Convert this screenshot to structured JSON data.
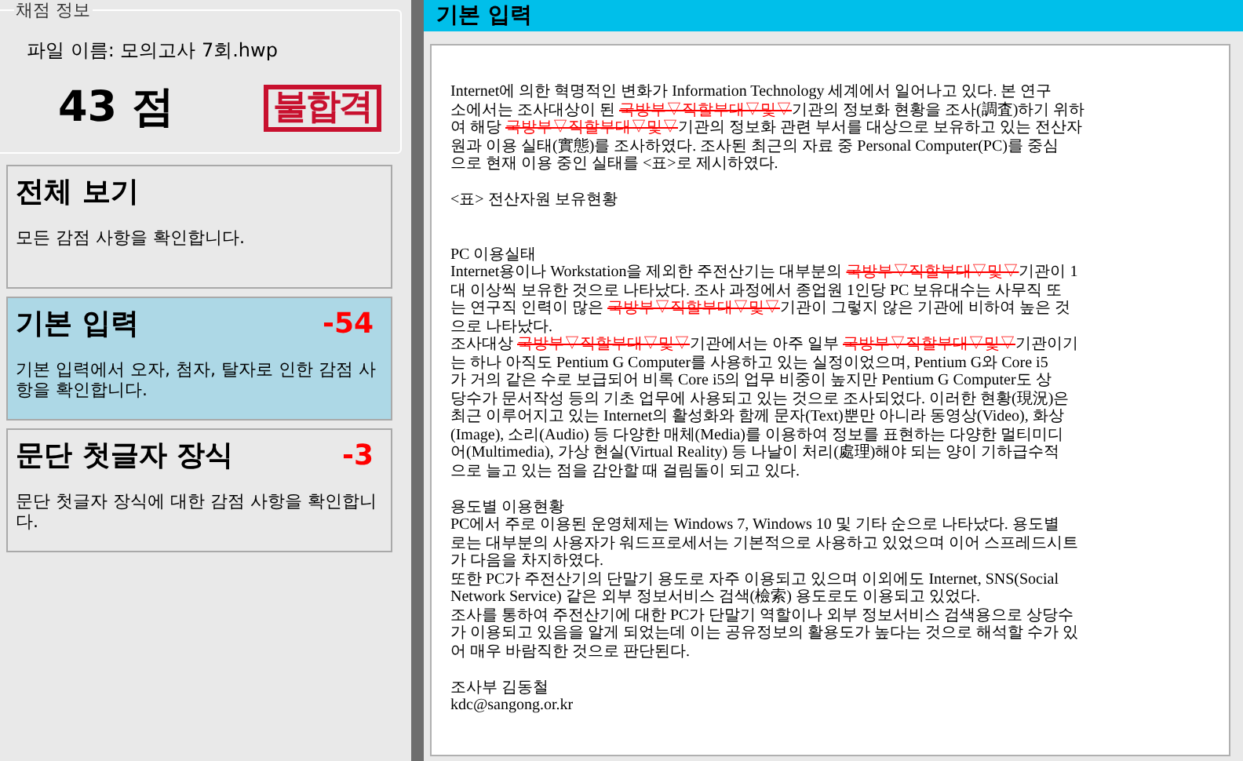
{
  "score_panel": {
    "title": "채점 정보",
    "file_name": "파일 이름: 모의고사 7회.hwp",
    "score": "43 점",
    "result_stamp": "불합격"
  },
  "categories": [
    {
      "title": "전체 보기",
      "description": "모든 감점 사항을 확인합니다.",
      "selected": false
    },
    {
      "title": "기본 입력",
      "deduction": "-54",
      "description": "기본 입력에서 오자, 첨자, 탈자로 인한 감점 사항을 확인합니다.",
      "selected": true
    },
    {
      "title": "문단 첫글자 장식",
      "deduction": "-3",
      "description": "문단 첫글자 장식에 대한 감점 사항을 확인합니다.",
      "selected": false
    }
  ],
  "header": {
    "title": "기본 입력"
  },
  "document": {
    "blocks": [
      {
        "kind": "paragraph",
        "lines": [
          [
            {
              "kind": "text",
              "text": "Internet에 의한 혁명적인 변화가 Information Technology 세계에서 일어나고 있다. 본 연구"
            }
          ],
          [
            {
              "kind": "text",
              "text": "소에서는 조사대상이 된 "
            },
            {
              "kind": "struck",
              "text": "국방부▽직할부대▽및▽"
            },
            {
              "kind": "text",
              "text": "기관의 정보화 현황을 조사(調査)하기 위하"
            }
          ],
          [
            {
              "kind": "text",
              "text": "여 해당 "
            },
            {
              "kind": "struck",
              "text": "국방부▽직할부대▽및▽"
            },
            {
              "kind": "text",
              "text": "기관의 정보화 관련 부서를 대상으로 보유하고 있는 전산자"
            }
          ],
          [
            {
              "kind": "text",
              "text": "원과 이용 실태(實態)를 조사하였다. 조사된 최근의 자료 중 Personal Computer(PC)를 중심"
            }
          ],
          [
            {
              "kind": "text",
              "text": "으로 현재 이용 중인 실태를 <표>로 제시하였다."
            }
          ]
        ]
      },
      {
        "kind": "caption",
        "lines": [
          [
            {
              "kind": "text",
              "text": "<표> 전산자원 보유현황"
            }
          ]
        ]
      },
      {
        "kind": "paragraph",
        "lines": [
          [
            {
              "kind": "text",
              "text": "PC 이용실태"
            }
          ],
          [
            {
              "kind": "text",
              "text": "Internet용이나 Workstation을 제외한 주전산기는 대부분의 "
            },
            {
              "kind": "struck",
              "text": "국방부▽직할부대▽및▽"
            },
            {
              "kind": "text",
              "text": "기관이 1"
            }
          ],
          [
            {
              "kind": "text",
              "text": "대 이상씩 보유한 것으로 나타났다. 조사 과정에서 종업원 1인당 PC 보유대수는 사무직 또"
            }
          ],
          [
            {
              "kind": "text",
              "text": "는 연구직 인력이 많은 "
            },
            {
              "kind": "struck",
              "text": "국방부▽직할부대▽및▽"
            },
            {
              "kind": "text",
              "text": "기관이 그렇지 않은 기관에 비하여 높은 것"
            }
          ],
          [
            {
              "kind": "text",
              "text": "으로 나타났다."
            }
          ],
          [
            {
              "kind": "text",
              "text": "조사대상 "
            },
            {
              "kind": "struck",
              "text": "국방부▽직할부대▽및▽"
            },
            {
              "kind": "text",
              "text": "기관에서는 아주 일부 "
            },
            {
              "kind": "struck",
              "text": "국방부▽직할부대▽및▽"
            },
            {
              "kind": "text",
              "text": "기관이기"
            }
          ],
          [
            {
              "kind": "text",
              "text": "는 하나 아직도 Pentium G Computer를 사용하고 있는 실정이었으며, Pentium G와 Core i5"
            }
          ],
          [
            {
              "kind": "text",
              "text": "가 거의 같은 수로 보급되어 비록 Core i5의 업무 비중이 높지만 Pentium G Computer도 상"
            }
          ],
          [
            {
              "kind": "text",
              "text": "당수가 문서작성 등의 기초 업무에 사용되고 있는 것으로 조사되었다. 이러한 현황(現況)은"
            }
          ],
          [
            {
              "kind": "text",
              "text": "최근 이루어지고 있는 Internet의 활성화와 함께 문자(Text)뿐만 아니라 동영상(Video), 화상"
            }
          ],
          [
            {
              "kind": "text",
              "text": "(Image), 소리(Audio) 등 다양한 매체(Media)를 이용하여 정보를 표현하는 다양한 멀티미디"
            }
          ],
          [
            {
              "kind": "text",
              "text": "어(Multimedia), 가상 현실(Virtual Reality) 등 나날이 처리(處理)해야 되는 양이 기하급수적"
            }
          ],
          [
            {
              "kind": "text",
              "text": "으로 늘고 있는 점을 감안할 때 걸림돌이 되고 있다."
            }
          ]
        ]
      },
      {
        "kind": "paragraph",
        "lines": [
          [
            {
              "kind": "text",
              "text": "용도별 이용현황"
            }
          ],
          [
            {
              "kind": "text",
              "text": "PC에서 주로 이용된 운영체제는 Windows 7, Windows 10 및 기타 순으로 나타났다. 용도별"
            }
          ],
          [
            {
              "kind": "text",
              "text": "로는 대부분의 사용자가 워드프로세서는 기본적으로 사용하고 있었으며 이어 스프레드시트"
            }
          ],
          [
            {
              "kind": "text",
              "text": "가 다음을 차지하였다."
            }
          ],
          [
            {
              "kind": "text",
              "text": "또한 PC가 주전산기의 단말기 용도로 자주 이용되고 있으며 이외에도 Internet, SNS(Social"
            }
          ],
          [
            {
              "kind": "text",
              "text": "Network Service) 같은 외부 정보서비스 검색(檢索) 용도로도 이용되고 있었다."
            }
          ],
          [
            {
              "kind": "text",
              "text": "조사를 통하여 주전산기에 대한 PC가 단말기 역할이나 외부 정보서비스 검색용으로 상당수"
            }
          ],
          [
            {
              "kind": "text",
              "text": "가 이용되고 있음을 알게 되었는데 이는 공유정보의 활용도가 높다는 것으로 해석할 수가 있"
            }
          ],
          [
            {
              "kind": "text",
              "text": "어 매우 바람직한 것으로 판단된다."
            }
          ]
        ]
      },
      {
        "kind": "paragraph",
        "lines": [
          [
            {
              "kind": "text",
              "text": "조사부 김동철"
            }
          ],
          [
            {
              "kind": "text",
              "text": "kdc@sangong.or.kr"
            }
          ]
        ]
      }
    ]
  }
}
